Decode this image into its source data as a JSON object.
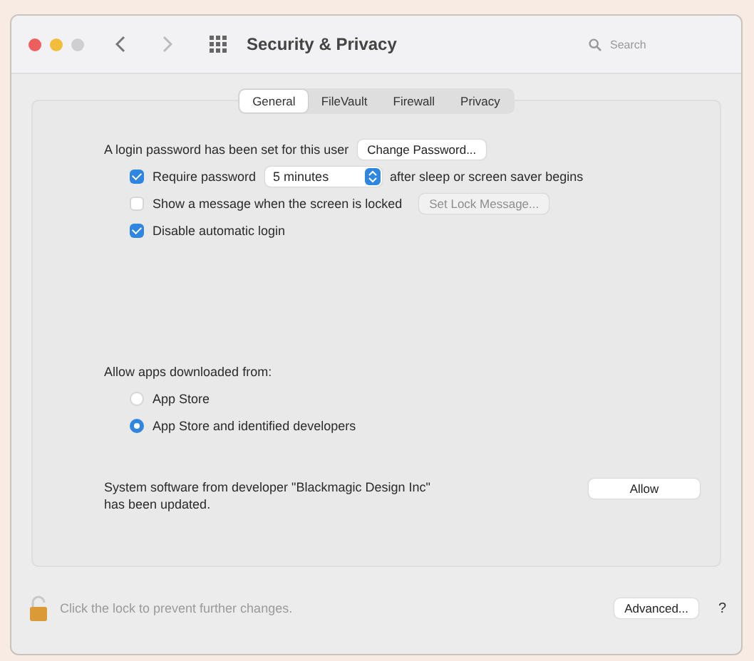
{
  "window": {
    "title": "Security & Privacy",
    "search": {
      "placeholder": "Search"
    }
  },
  "tabs": [
    {
      "label": "General",
      "selected": true
    },
    {
      "label": "FileVault",
      "selected": false
    },
    {
      "label": "Firewall",
      "selected": false
    },
    {
      "label": "Privacy",
      "selected": false
    }
  ],
  "password": {
    "text": "A login password has been set for this user",
    "button": "Change Password..."
  },
  "options": [
    {
      "kind": "require",
      "label": "Require password",
      "checked": true,
      "value": "5 minutes",
      "suffix": "after sleep or screen saver begins"
    },
    {
      "kind": "message",
      "label": "Show a message when the screen is locked",
      "checked": false,
      "button": "Set Lock Message...",
      "disabled": true
    },
    {
      "kind": "plain",
      "label": "Disable automatic login",
      "checked": true
    }
  ],
  "allow_apps": {
    "label": "Allow apps downloaded from:",
    "choices": [
      {
        "label": "App Store",
        "selected": false
      },
      {
        "label": "App Store and identified developers",
        "selected": true
      }
    ]
  },
  "notice": {
    "text": "System software from developer \"Blackmagic Design Inc\" has been updated.",
    "button": "Allow"
  },
  "footer": {
    "text": "Click the lock to prevent further changes.",
    "advanced": "Advanced...",
    "help": "?"
  }
}
